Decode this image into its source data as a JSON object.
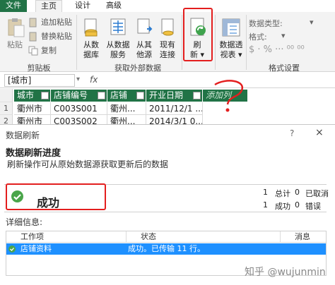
{
  "ribbon_tabs": [
    {
      "label": "文件"
    },
    {
      "label": "主页"
    },
    {
      "label": "设计"
    },
    {
      "label": "高级"
    }
  ],
  "clipboard": {
    "paste_label": "粘贴",
    "append_paste_label": "追加粘贴",
    "replace_paste_label": "替换粘贴",
    "copy_label": "复制",
    "group_label": "剪贴板"
  },
  "external": {
    "from_db": {
      "line1": "从数",
      "line2": "据库"
    },
    "from_service": {
      "line1": "从数据",
      "line2": "服务"
    },
    "from_other": {
      "line1": "从其",
      "line2": "他源"
    },
    "existing": {
      "line1": "现有",
      "line2": "连接"
    },
    "group_label": "获取外部数据"
  },
  "refresh": {
    "line1": "刷",
    "line2": "新"
  },
  "pivot": {
    "line1": "数据透",
    "line2": "视表"
  },
  "format": {
    "data_type_label": "数据类型:",
    "format_label": "格式:",
    "group_label": "格式设置"
  },
  "formula_bar": {
    "name_box": "[城市]",
    "fx": "fx"
  },
  "sheet": {
    "columns": [
      "城市",
      "店铺编号",
      "店铺",
      "开业日期",
      "添加列"
    ],
    "rows": [
      {
        "num": "1",
        "cells": [
          "衢州市",
          "C003S001",
          "衢州...",
          "2011/12/1 ..."
        ]
      },
      {
        "num": "2",
        "cells": [
          "衢州市",
          "C003S002",
          "衢州...",
          "2014/3/1 0..."
        ]
      }
    ]
  },
  "dialog": {
    "title": "数据刷新",
    "help": "?",
    "close": "×",
    "header": "数据刷新进度",
    "subtitle": "刷新操作可从原始数据源获取更新后的数据",
    "status_text": "成功",
    "total_count": "1",
    "total_label": "总计",
    "stopped_count": "0",
    "stopped_label": "已取消",
    "success_count": "1",
    "success_label": "成功",
    "error_count": "0",
    "error_label": "错误",
    "details_label": "详细信息:",
    "grid_headers": [
      "工作项",
      "状态",
      "消息"
    ],
    "grid_rows": [
      {
        "item": "店铺资料",
        "status": "成功。已传输 11 行。",
        "message": ""
      }
    ]
  },
  "watermark": "知乎 @wujunmin",
  "colors": {
    "excel_green": "#217346",
    "annotation_red": "#e31e1e",
    "selection_blue": "#1e90ff"
  }
}
